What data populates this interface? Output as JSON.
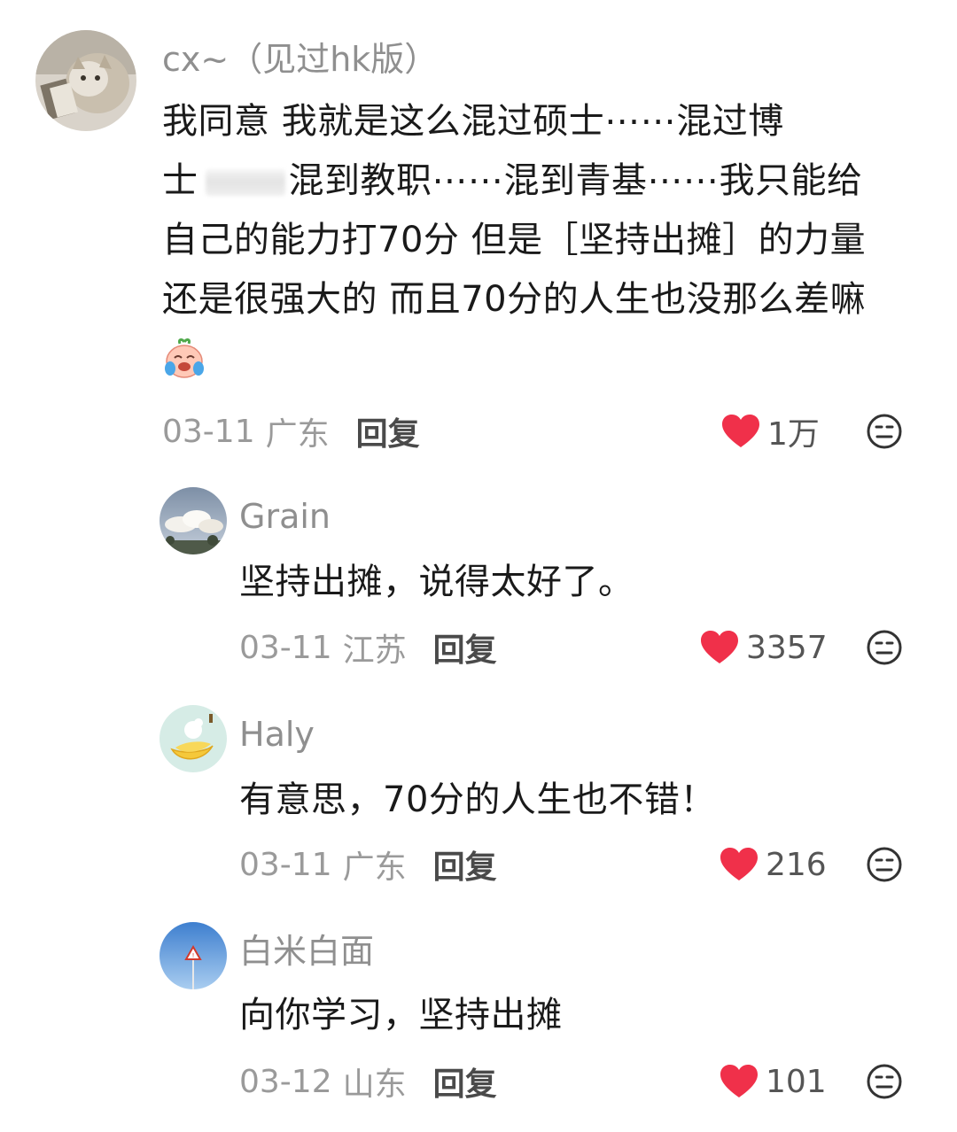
{
  "comments": [
    {
      "username": "cx~（见过hk版）",
      "content_lines": [
        "我同意 我就是这么混过硕士⋯⋯混过博",
        "士",
        "混到教职⋯⋯混到青基⋯⋯我只能给",
        "自己的能力打70分 但是［坚持出摊］的力量",
        "还是很强大的 而且70分的人生也没那么差嘛"
      ],
      "date": "03-11",
      "region": "广东",
      "reply_label": "回复",
      "likes": "1万"
    },
    {
      "username": "Grain",
      "content": "坚持出摊，说得太好了。",
      "date": "03-11",
      "region": "江苏",
      "reply_label": "回复",
      "likes": "3357"
    },
    {
      "username": "Haly",
      "content": "有意思，70分的人生也不错！",
      "date": "03-11",
      "region": "广东",
      "reply_label": "回复",
      "likes": "216"
    },
    {
      "username": "白米白面",
      "content": "向你学习，坚持出摊",
      "date": "03-12",
      "region": "山东",
      "reply_label": "回复",
      "likes": "101"
    }
  ],
  "icons": {
    "like": "heart-icon",
    "dislike": "dislike-face-icon",
    "emoji": "crying-peach-emoji"
  },
  "colors": {
    "heart": "#f0304a",
    "username": "#8f8f8f",
    "meta": "#9a9a9a",
    "text": "#1a1a1a"
  }
}
